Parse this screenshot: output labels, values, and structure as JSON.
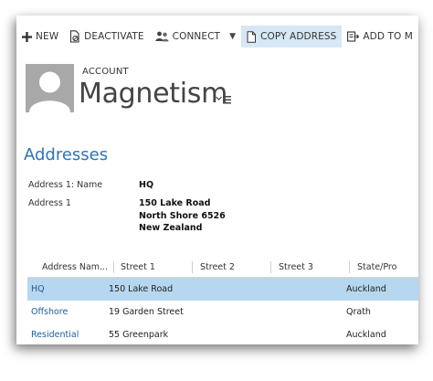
{
  "toolbar": {
    "new_label": "NEW",
    "deactivate_label": "DEACTIVATE",
    "connect_label": "CONNECT",
    "copy_address_label": "COPY ADDRESS",
    "add_to_label": "ADD TO M"
  },
  "header": {
    "entity_label": "ACCOUNT",
    "record_name": "Magnetism"
  },
  "addresses": {
    "section_title": "Addresses",
    "fields": [
      {
        "label": "Address 1: Name",
        "value": "HQ"
      },
      {
        "label": "Address 1",
        "lines": [
          "150 Lake Road",
          "North Shore 6526",
          "New Zealand"
        ]
      }
    ]
  },
  "grid": {
    "columns": [
      "Address Nam...",
      "Street 1",
      "Street 2",
      "Street 3",
      "State/Pro"
    ],
    "rows": [
      {
        "name": "HQ",
        "street1": "150 Lake Road",
        "street2": "",
        "street3": "",
        "state": "Auckland",
        "selected": true
      },
      {
        "name": "Offshore",
        "street1": "19 Garden Street",
        "street2": "",
        "street3": "",
        "state": "Qrath",
        "selected": false
      },
      {
        "name": "Residential",
        "street1": "55 Greenpark",
        "street2": "",
        "street3": "",
        "state": "Auckland",
        "selected": false
      }
    ]
  },
  "colors": {
    "accent": "#2e74b5",
    "selected_row": "#b6d7ef",
    "active_button": "#d7e7f5",
    "link": "#1e5c9e"
  }
}
